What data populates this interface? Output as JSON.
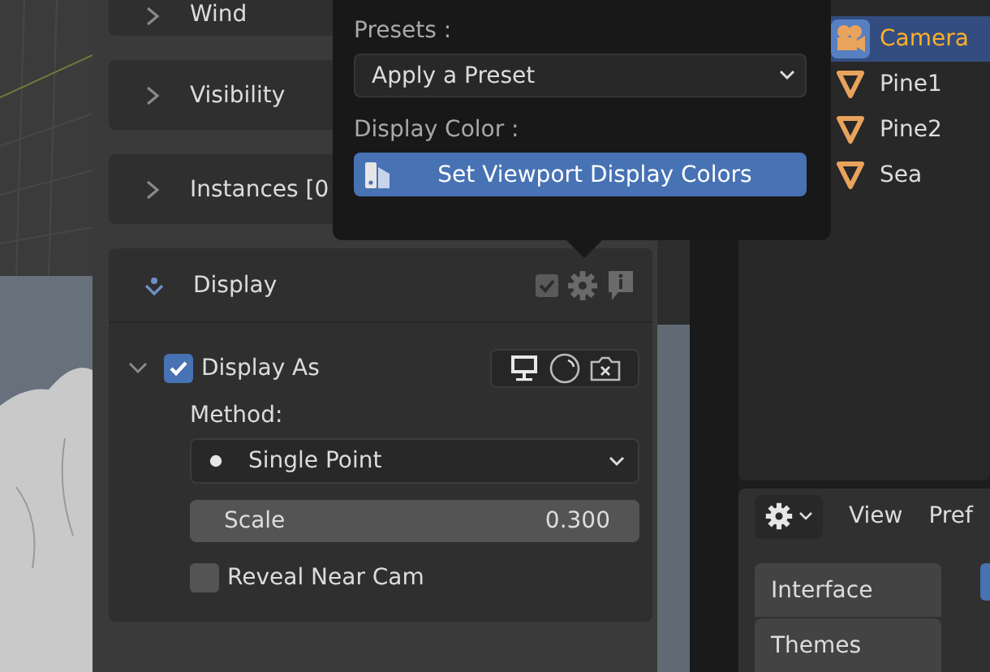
{
  "properties": {
    "panels": [
      {
        "title": "Wind",
        "expanded": false
      },
      {
        "title": "Visibility",
        "expanded": false
      },
      {
        "title": "Instances [0",
        "expanded": false
      },
      {
        "title": "Display",
        "expanded": true
      }
    ]
  },
  "display": {
    "display_as": {
      "label": "Display As",
      "checked": true,
      "expanded": true
    },
    "method_label": "Method:",
    "method": "Single Point",
    "scale": {
      "label": "Scale",
      "value": "0.300"
    },
    "reveal_near_cam": {
      "label": "Reveal Near Cam",
      "checked": false
    }
  },
  "popup": {
    "presets_label": "Presets :",
    "preset_dropdown": "Apply a Preset",
    "display_color_label": "Display Color :",
    "button": "Set Viewport Display Colors"
  },
  "outliner": {
    "items": [
      {
        "name": "Camera",
        "kind": "camera",
        "selected": true
      },
      {
        "name": "Pine1",
        "kind": "mesh",
        "selected": false
      },
      {
        "name": "Pine2",
        "kind": "mesh",
        "selected": false
      },
      {
        "name": "Sea",
        "kind": "mesh",
        "selected": false
      }
    ]
  },
  "preferences": {
    "menu": [
      "View",
      "Pref"
    ],
    "tabs": [
      {
        "label": "Interface",
        "selected": false
      },
      {
        "label": "Themes",
        "selected": false
      }
    ]
  }
}
